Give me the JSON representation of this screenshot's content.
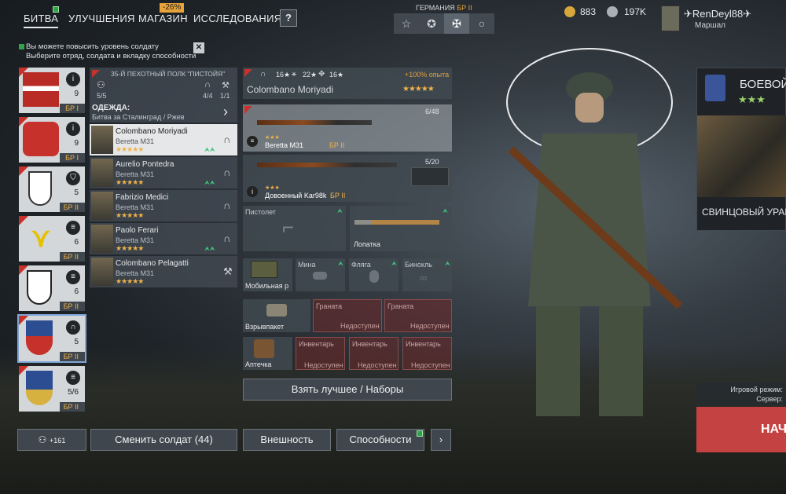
{
  "nav": {
    "tabs": [
      "БИТВА",
      "УЛУЧШЕНИЯ",
      "МАГАЗИН",
      "ИССЛЕДОВАНИЯ"
    ],
    "discount": "-26%",
    "help": "?"
  },
  "nation": {
    "label": "ГЕРМАНИЯ",
    "br": "БР II",
    "icons": [
      "☆",
      "✪",
      "✠",
      "○"
    ]
  },
  "currency": {
    "gold": "883",
    "silver": "197K"
  },
  "player": {
    "name": "RenDeyl88",
    "rank": "Маршал"
  },
  "notice": {
    "line1": "Вы можете повысить уровень солдату",
    "line2": "Выберите отряд, солдата и вкладку способности"
  },
  "squads": [
    {
      "count": "9",
      "br": "БР I",
      "icon": "i"
    },
    {
      "count": "9",
      "br": "БР I",
      "icon": "i"
    },
    {
      "count": "5",
      "br": "БР II",
      "icon": "shield"
    },
    {
      "count": "6",
      "br": "БР II",
      "icon": "list"
    },
    {
      "count": "6",
      "br": "БР II",
      "icon": "list"
    },
    {
      "count": "5",
      "br": "БР II",
      "icon": "headphones"
    },
    {
      "count": "5/6",
      "br": "БР II",
      "icon": "list"
    }
  ],
  "regiment": {
    "title": "35-Й ПЕХОТНЫЙ ПОЛК \"ПИСТОЙЯ\"",
    "members": "5/5",
    "radio": "4/4",
    "eng": "1/1",
    "clothes_label": "ОДЕЖДА:",
    "clothes_value": "Битва за Сталинград / Ржев"
  },
  "soldiers": [
    {
      "name": "Colombano Moriyadi",
      "weapon": "Beretta M31",
      "stars": "★★★★★"
    },
    {
      "name": "Aurelio Pontedra",
      "weapon": "Beretta M31",
      "stars": "★★★★★"
    },
    {
      "name": "Fabrizio Medici",
      "weapon": "Beretta M31",
      "stars": "★★★★★"
    },
    {
      "name": "Paolo Ferari",
      "weapon": "Beretta M31",
      "stars": "★★★★★"
    },
    {
      "name": "Colombano Pelagatti",
      "weapon": "Beretta M31",
      "stars": "★★★★★"
    }
  ],
  "selected": {
    "name": "Colombano Moriyadi",
    "stats": [
      "16★",
      "22★",
      "16★"
    ],
    "exp_bonus": "+100% опыта",
    "stars": "★★★★★"
  },
  "weapons": [
    {
      "name": "Beretta M31",
      "br": "БР II",
      "ammo": "6/48"
    },
    {
      "name": "Довоенный Kar98k",
      "br": "БР II",
      "ammo": "5/20"
    }
  ],
  "slots": {
    "pistol": "Пистолет",
    "shovel": "Лопатка",
    "radio": "Мобильная р",
    "mine": "Мина",
    "flask": "Фляга",
    "binoc": "Бинокль",
    "explosive": "Взрывпакет",
    "grenade": "Граната",
    "medkit": "Аптечка",
    "inventory": "Инвентарь",
    "unavailable": "Недоступен"
  },
  "buttons": {
    "best": "Взять лучшее / Наборы",
    "squad_count": "+161",
    "change": "Сменить солдат (44)",
    "appearance": "Внешность",
    "abilities": "Способности",
    "next": "›"
  },
  "event": {
    "title": "БОЕВОЙ",
    "stars": "★★★",
    "name": "СВИНЦОВЫЙ УРАГ"
  },
  "mode": {
    "line1": "Игровой режим:",
    "line2": "Сервер:",
    "play": "НАЧА"
  }
}
